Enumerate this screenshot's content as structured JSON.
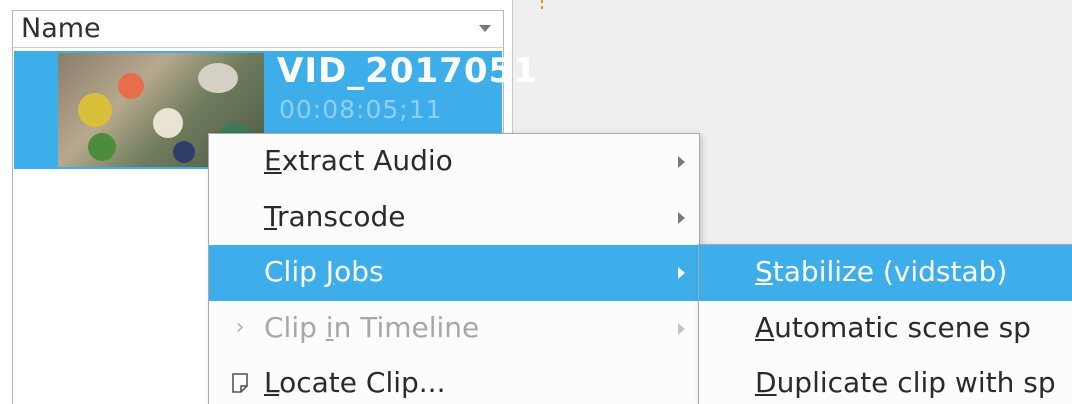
{
  "bin": {
    "column_header": "Name",
    "clip": {
      "name": "VID_201705",
      "name_tail": "1",
      "duration": "00:08:05;11"
    }
  },
  "context_menu": {
    "items": [
      {
        "pre": "",
        "u": "E",
        "post": "xtract Audio",
        "state": "normal",
        "submenu": true,
        "icon": ""
      },
      {
        "pre": "",
        "u": "T",
        "post": "ranscode",
        "state": "normal",
        "submenu": true,
        "icon": ""
      },
      {
        "pre": "Clip ",
        "u": "J",
        "post": "obs",
        "state": "highlighted",
        "submenu": true,
        "icon": ""
      },
      {
        "pre": "Clip ",
        "u": "i",
        "post": "n Timeline",
        "state": "disabled",
        "submenu": true,
        "icon": "timeline-arrow-icon"
      },
      {
        "pre": "",
        "u": "L",
        "post": "ocate Clip...",
        "state": "normal",
        "submenu": false,
        "icon": "locate-clip-icon"
      }
    ]
  },
  "clip_jobs_submenu": {
    "items": [
      {
        "pre": "",
        "u": "S",
        "post": "tabilize (vidstab)",
        "state": "highlighted"
      },
      {
        "pre": "",
        "u": "A",
        "post": "utomatic scene sp",
        "state": "normal"
      },
      {
        "pre": "",
        "u": "D",
        "post": "uplicate clip with sp",
        "state": "normal"
      }
    ]
  },
  "colors": {
    "highlight": "#3daee9",
    "marker": "#f08a24"
  }
}
